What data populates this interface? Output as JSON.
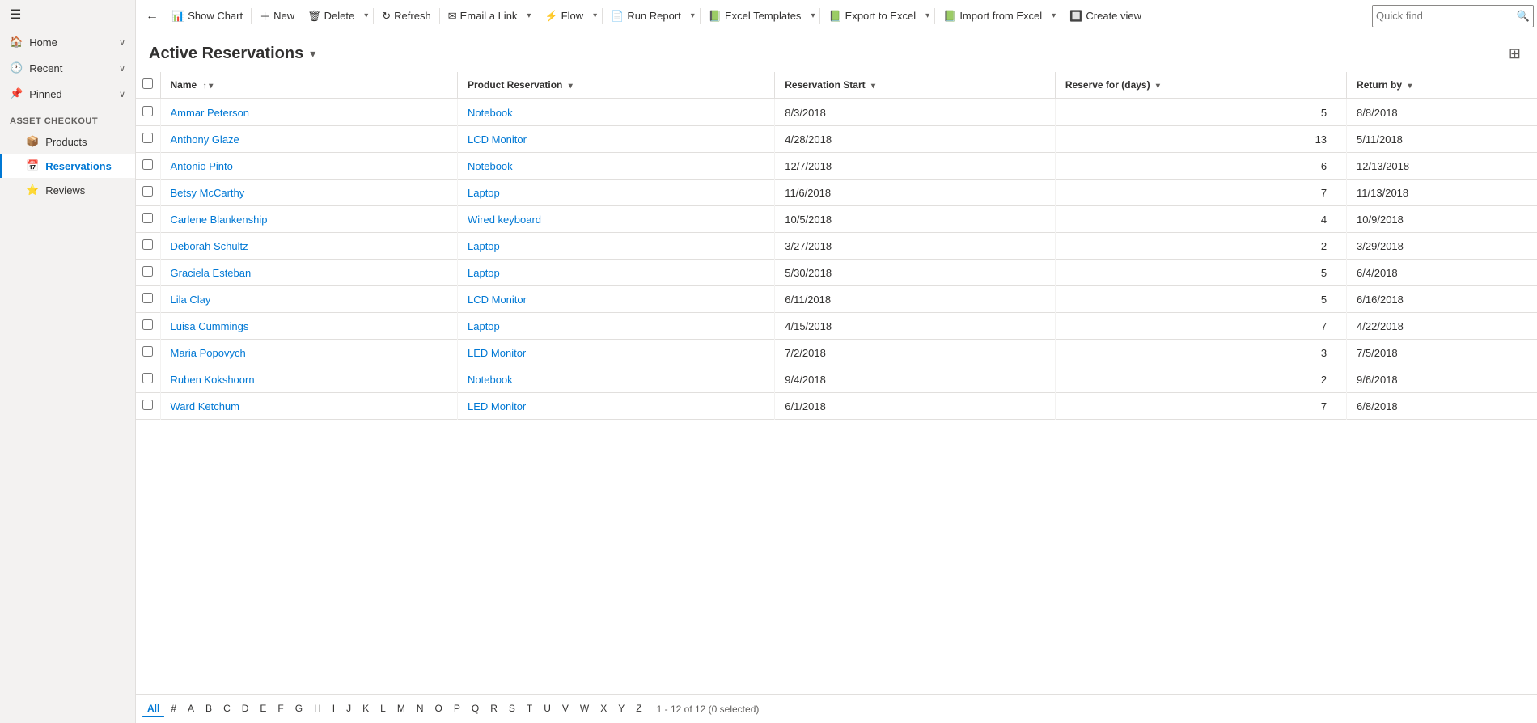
{
  "sidebar": {
    "section_label": "Asset Checkout",
    "nav_items": [
      {
        "id": "home",
        "label": "Home",
        "icon": "🏠",
        "expandable": true
      },
      {
        "id": "recent",
        "label": "Recent",
        "icon": "🕐",
        "expandable": true
      },
      {
        "id": "pinned",
        "label": "Pinned",
        "icon": "📌",
        "expandable": true
      }
    ],
    "sub_items": [
      {
        "id": "products",
        "label": "Products",
        "icon": "📦"
      },
      {
        "id": "reservations",
        "label": "Reservations",
        "icon": "📅",
        "active": true
      },
      {
        "id": "reviews",
        "label": "Reviews",
        "icon": "⭐"
      }
    ]
  },
  "toolbar": {
    "back_label": "←",
    "show_chart_label": "Show Chart",
    "new_label": "New",
    "delete_label": "Delete",
    "refresh_label": "Refresh",
    "email_link_label": "Email a Link",
    "flow_label": "Flow",
    "run_report_label": "Run Report",
    "excel_templates_label": "Excel Templates",
    "export_to_excel_label": "Export to Excel",
    "import_from_excel_label": "Import from Excel",
    "create_view_label": "Create view",
    "quick_find_placeholder": "Quick find",
    "quick_find_value": ""
  },
  "page": {
    "title": "Active Reservations",
    "filter_icon": "⊞"
  },
  "table": {
    "columns": [
      {
        "id": "name",
        "label": "Name",
        "sortable": true,
        "sort_dir": "asc"
      },
      {
        "id": "product",
        "label": "Product Reservation",
        "sortable": true
      },
      {
        "id": "reservation_start",
        "label": "Reservation Start",
        "sortable": true
      },
      {
        "id": "reserve_for_days",
        "label": "Reserve for (days)",
        "sortable": true
      },
      {
        "id": "return_by",
        "label": "Return by",
        "sortable": true
      }
    ],
    "rows": [
      {
        "name": "Ammar Peterson",
        "product": "Notebook",
        "reservation_start": "8/3/2018",
        "reserve_for_days": 5,
        "return_by": "8/8/2018"
      },
      {
        "name": "Anthony Glaze",
        "product": "LCD Monitor",
        "reservation_start": "4/28/2018",
        "reserve_for_days": 13,
        "return_by": "5/11/2018"
      },
      {
        "name": "Antonio Pinto",
        "product": "Notebook",
        "reservation_start": "12/7/2018",
        "reserve_for_days": 6,
        "return_by": "12/13/2018"
      },
      {
        "name": "Betsy McCarthy",
        "product": "Laptop",
        "reservation_start": "11/6/2018",
        "reserve_for_days": 7,
        "return_by": "11/13/2018"
      },
      {
        "name": "Carlene Blankenship",
        "product": "Wired keyboard",
        "reservation_start": "10/5/2018",
        "reserve_for_days": 4,
        "return_by": "10/9/2018"
      },
      {
        "name": "Deborah Schultz",
        "product": "Laptop",
        "reservation_start": "3/27/2018",
        "reserve_for_days": 2,
        "return_by": "3/29/2018"
      },
      {
        "name": "Graciela Esteban",
        "product": "Laptop",
        "reservation_start": "5/30/2018",
        "reserve_for_days": 5,
        "return_by": "6/4/2018"
      },
      {
        "name": "Lila Clay",
        "product": "LCD Monitor",
        "reservation_start": "6/11/2018",
        "reserve_for_days": 5,
        "return_by": "6/16/2018"
      },
      {
        "name": "Luisa Cummings",
        "product": "Laptop",
        "reservation_start": "4/15/2018",
        "reserve_for_days": 7,
        "return_by": "4/22/2018"
      },
      {
        "name": "Maria Popovych",
        "product": "LED Monitor",
        "reservation_start": "7/2/2018",
        "reserve_for_days": 3,
        "return_by": "7/5/2018"
      },
      {
        "name": "Ruben Kokshoorn",
        "product": "Notebook",
        "reservation_start": "9/4/2018",
        "reserve_for_days": 2,
        "return_by": "9/6/2018"
      },
      {
        "name": "Ward Ketchum",
        "product": "LED Monitor",
        "reservation_start": "6/1/2018",
        "reserve_for_days": 7,
        "return_by": "6/8/2018"
      }
    ]
  },
  "pagination": {
    "letters": [
      "All",
      "#",
      "A",
      "B",
      "C",
      "D",
      "E",
      "F",
      "G",
      "H",
      "I",
      "J",
      "K",
      "L",
      "M",
      "N",
      "O",
      "P",
      "Q",
      "R",
      "S",
      "T",
      "U",
      "V",
      "W",
      "X",
      "Y",
      "Z"
    ],
    "active_letter": "All",
    "info": "1 - 12 of 12 (0 selected)"
  }
}
